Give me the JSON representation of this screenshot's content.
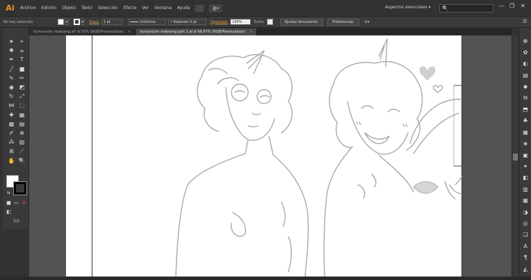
{
  "app": {
    "logo": "Ai"
  },
  "menu": [
    "Archivo",
    "Edición",
    "Objeto",
    "Texto",
    "Selección",
    "Efecto",
    "Ver",
    "Ventana",
    "Ayuda"
  ],
  "menubar": {
    "workspace": "Aspectos esenciales",
    "workspace_caret": "▾",
    "search_icon": "🔍",
    "window_buttons": [
      "—",
      "❐",
      "✕"
    ]
  },
  "control_bar": {
    "selection": "No hay selección",
    "stroke_label": "Trazo:",
    "stroke_weight": "1 pt",
    "profile": "Uniforme",
    "brush": "Redondo 5 pt",
    "opacity_label": "Opacidad:",
    "opacity_value": "100%",
    "style_label": "Estilo:",
    "adjust_doc_button": "Ajustar documento",
    "preferences_button": "Preferencias"
  },
  "tabs": [
    {
      "label": "humancom redeseng.ai* al 50% (RGB/Previsualizar)",
      "close": "×",
      "active": false
    },
    {
      "label": "humancom redeseng part 2.ai al 66.67% (RGB/Previsualizar)",
      "close": "×",
      "active": true
    }
  ],
  "tools": [
    {
      "name": "selection-tool",
      "glyph": "➤"
    },
    {
      "name": "direct-selection-tool",
      "glyph": "➢"
    },
    {
      "name": "magic-wand-tool",
      "glyph": "✱"
    },
    {
      "name": "lasso-tool",
      "glyph": "ⴰ"
    },
    {
      "name": "pen-tool",
      "glyph": "✒"
    },
    {
      "name": "type-tool",
      "glyph": "T"
    },
    {
      "name": "line-tool",
      "glyph": "╱"
    },
    {
      "name": "rectangle-tool",
      "glyph": "■"
    },
    {
      "name": "paintbrush-tool",
      "glyph": "✎"
    },
    {
      "name": "pencil-tool",
      "glyph": "✏"
    },
    {
      "name": "blob-brush-tool",
      "glyph": "◉"
    },
    {
      "name": "eraser-tool",
      "glyph": "◩"
    },
    {
      "name": "rotate-tool",
      "glyph": "↻"
    },
    {
      "name": "scale-tool",
      "glyph": "⤢"
    },
    {
      "name": "width-tool",
      "glyph": "⋈"
    },
    {
      "name": "free-transform-tool",
      "glyph": "⬚"
    },
    {
      "name": "shape-builder-tool",
      "glyph": "✚"
    },
    {
      "name": "perspective-grid-tool",
      "glyph": "▦"
    },
    {
      "name": "mesh-tool",
      "glyph": "▩"
    },
    {
      "name": "gradient-tool",
      "glyph": "▤"
    },
    {
      "name": "eyedropper-tool",
      "glyph": "✐"
    },
    {
      "name": "blend-tool",
      "glyph": "⊕"
    },
    {
      "name": "symbol-sprayer-tool",
      "glyph": "⁂"
    },
    {
      "name": "column-graph-tool",
      "glyph": "▥"
    },
    {
      "name": "artboard-tool",
      "glyph": "⊞"
    },
    {
      "name": "slice-tool",
      "glyph": "⟋"
    },
    {
      "name": "hand-tool",
      "glyph": "✋"
    },
    {
      "name": "zoom-tool",
      "glyph": "🔍"
    }
  ],
  "color_modes": [
    "■",
    "▭",
    "⊘"
  ],
  "screen_mode_glyph": "▭",
  "panel_icons": [
    "❁",
    "✿",
    "◐",
    "▤",
    "◆",
    "⧉",
    "⬒",
    "♣",
    "▦",
    "◈",
    "▣",
    "✦",
    "◧",
    "▥",
    "▦",
    "◑",
    "◎",
    "❏",
    "A",
    "¶",
    "◭"
  ],
  "colors": {
    "fill": "#ffffff",
    "stroke": "#000000",
    "accent": "#e3a04a"
  }
}
